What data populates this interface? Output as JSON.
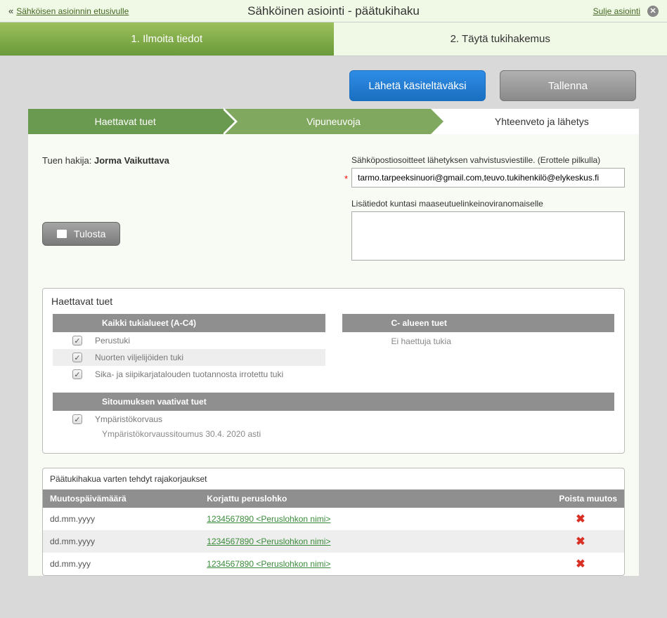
{
  "topbar": {
    "back_link": "Sähköisen asioinnin etusivulle",
    "title": "Sähköinen asiointi - päätukihaku",
    "close_link": "Sulje asiointi"
  },
  "main_tabs": {
    "tab1": "1. Ilmoita tiedot",
    "tab2": "2. Täytä tukihakemus"
  },
  "actions": {
    "submit": "Lähetä käsiteltäväksi",
    "save": "Tallenna"
  },
  "stepper": {
    "s1": "Haettavat tuet",
    "s2": "Vipuneuvoja",
    "s3": "Yhteenveto ja lähetys"
  },
  "form": {
    "applicant_label": "Tuen hakija:",
    "applicant_name": "Jorma Vaikuttava",
    "print": "Tulosta",
    "email_label": "Sähköpostiosoitteet lähetyksen vahvistusviestille. (Erottele pilkulla)",
    "email_value": "tarmo.tarpeeksinuori@gmail.com,teuvo.tukihenkilö@elykeskus.fi",
    "info_label": "Lisätiedot kuntasi maaseutuelinkeinoviranomaiselle",
    "info_value": ""
  },
  "tuet_panel": {
    "title": "Haettavat tuet",
    "left_header": "Kaikki tukialueet (A-C4)",
    "items_left": [
      {
        "label": "Perustuki",
        "checked": true
      },
      {
        "label": "Nuorten viljelijöiden tuki",
        "checked": true
      },
      {
        "label": "Sika- ja siipikarjatalouden tuotannosta irrotettu tuki",
        "checked": true
      }
    ],
    "right_header": "C- alueen tuet",
    "right_empty": "Ei haettuja tukia",
    "commit_header": "Sitoumuksen vaativat tuet",
    "commit_items": [
      {
        "label": "Ympäristökorvaus",
        "checked": true,
        "note": "Ympäristökorvaussitoumus 30.4. 2020 asti"
      }
    ]
  },
  "corrections": {
    "title": "Päätukihakua varten tehdyt rajakorjaukset",
    "col_date": "Muutospäivämäärä",
    "col_block": "Korjattu peruslohko",
    "col_delete": "Poista muutos",
    "rows": [
      {
        "date": "dd.mm.yyyy",
        "link": "1234567890  <Peruslohkon nimi>"
      },
      {
        "date": "dd.mm.yyyy",
        "link": "1234567890  <Peruslohkon nimi>"
      },
      {
        "date": "dd.mm.yyy",
        "link": "1234567890  <Peruslohkon nimi>"
      }
    ]
  }
}
